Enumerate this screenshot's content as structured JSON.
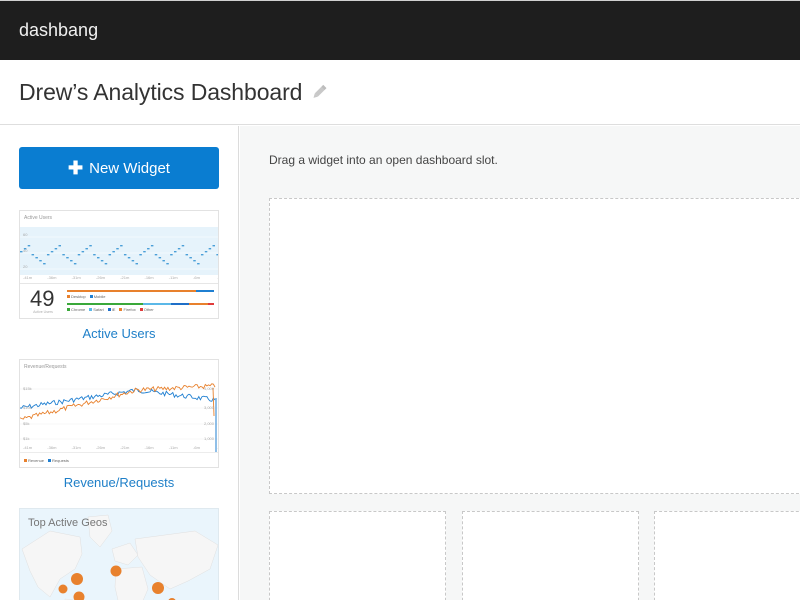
{
  "app": {
    "brand": "dashbang"
  },
  "header": {
    "title": "Drew’s Analytics Dashboard",
    "edit_icon": "pencil-icon"
  },
  "sidebar": {
    "new_widget_button": {
      "icon": "plus-icon",
      "label": "New Widget"
    },
    "widgets": [
      {
        "label": "Active Users",
        "preview": {
          "title": "Active Users",
          "y_ticks": [
            "60",
            "40",
            "20"
          ],
          "x_ticks": [
            "-41m",
            "-36m",
            "-31m",
            "-26m",
            "-21m",
            "-16m",
            "-11m",
            "-6m",
            "-1m"
          ],
          "count": "49",
          "count_label": "Active Users",
          "device_split": {
            "Desktop": 0.88,
            "Mobile": 0.12
          },
          "device_legend": [
            "Desktop",
            "Mobile"
          ],
          "browser_split": {
            "Chrome": 0.52,
            "Safari": 0.19,
            "IE": 0.12,
            "Firefox": 0.13,
            "Other": 0.04
          },
          "browser_legend": [
            "Chrome",
            "Safari",
            "IE",
            "Firefox",
            "Other"
          ],
          "colors": {
            "Desktop": "#e8812d",
            "Mobile": "#1f7fd1",
            "Chrome": "#3aa83a",
            "Safari": "#5bb8e8",
            "IE": "#1f6fc8",
            "Firefox": "#e8812d",
            "Other": "#e03b3b",
            "line": "#4a9fd8",
            "area": "#e6f3fb"
          }
        }
      },
      {
        "label": "Revenue/Requests",
        "preview": {
          "title": "Revenue/Requests",
          "y_ticks_left": [
            "$15k",
            "$10k",
            "$5k",
            "$1k"
          ],
          "y_ticks_right": [
            "4,000",
            "3,000",
            "2,000",
            "1,000"
          ],
          "x_ticks": [
            "-41m",
            "-36m",
            "-31m",
            "-26m",
            "-21m",
            "-16m",
            "-11m",
            "-6m",
            "-1m"
          ],
          "legend": [
            "Revenue",
            "Requests"
          ],
          "colors": {
            "Revenue": "#e8812d",
            "Requests": "#1f7fd1"
          }
        }
      },
      {
        "label": "Top Active Geos",
        "preview": {
          "title": "Top Active Geos",
          "marker_color": "#e8812d",
          "map_bg": "#eaf5fc"
        }
      }
    ]
  },
  "main": {
    "hint": "Drag a widget into an open dashboard slot.",
    "slots": [
      "slot-large",
      "slot-small-1",
      "slot-small-2",
      "slot-small-3"
    ]
  }
}
